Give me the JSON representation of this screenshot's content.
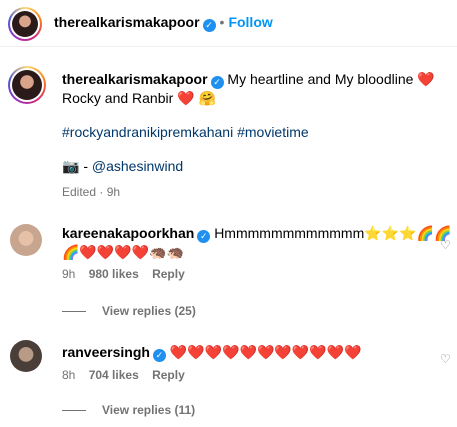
{
  "header": {
    "username": "therealkarismakapoor",
    "follow_label": "Follow"
  },
  "caption": {
    "username": "therealkarismakapoor",
    "text_line1": "My heartline and My bloodline",
    "text_line2": "Rocky and Ranbir",
    "hashtags": "#rockyandranikipremkahani #movietime",
    "credit_prefix": "📷 -",
    "credit_handle": "@ashesinwind",
    "meta": "Edited · 9h"
  },
  "comments": [
    {
      "username": "kareenakapoorkhan",
      "text": "Hmmmmmmmmmmmm",
      "line2": "🌈❤️❤️❤️❤️🦔🦔",
      "time": "9h",
      "likes": "980 likes",
      "reply": "Reply",
      "view_replies": "View replies (25)"
    },
    {
      "username": "ranveersingh",
      "text": "❤️❤️❤️❤️❤️❤️❤️❤️❤️❤️❤️",
      "time": "8h",
      "likes": "704 likes",
      "reply": "Reply",
      "view_replies": "View replies (11)"
    }
  ],
  "colors": {
    "link": "#0095f6",
    "hashtag": "#00376b",
    "muted": "#737373",
    "verified": "#1f8ff0"
  }
}
